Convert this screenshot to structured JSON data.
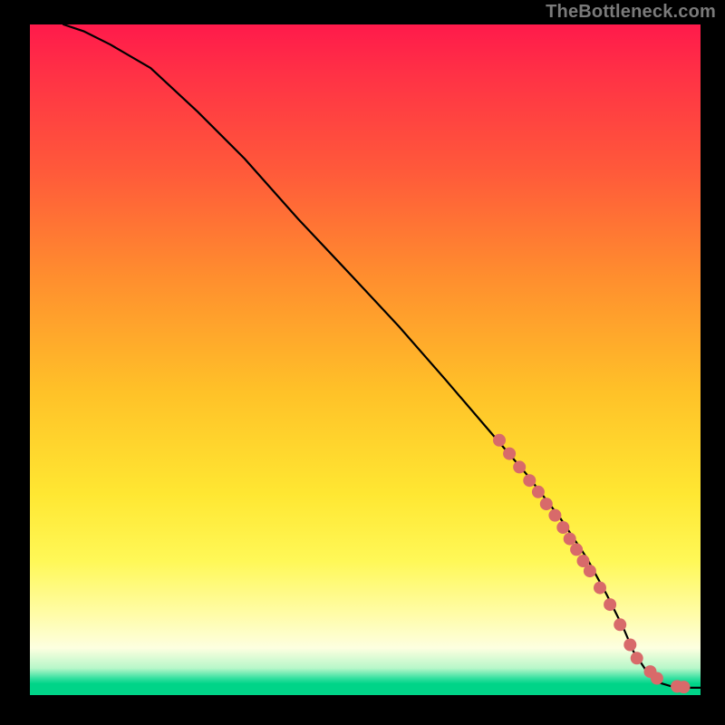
{
  "watermark": "TheBottleneck.com",
  "chart_data": {
    "type": "line",
    "title": "",
    "xlabel": "",
    "ylabel": "",
    "xlim": [
      0,
      100
    ],
    "ylim": [
      0,
      100
    ],
    "curve": {
      "name": "bottleneck-curve",
      "x": [
        5,
        8,
        12,
        18,
        25,
        32,
        40,
        48,
        55,
        62,
        68,
        74,
        79,
        83,
        86,
        88.5,
        90,
        92,
        94,
        96,
        98,
        100
      ],
      "y": [
        100,
        99,
        97,
        93.5,
        87,
        80,
        71,
        62.5,
        55,
        47,
        40,
        33,
        26.5,
        20.5,
        15,
        10,
        6.5,
        3.5,
        1.8,
        1.2,
        1.1,
        1.1
      ]
    },
    "markers": {
      "name": "highlighted-points",
      "color": "#d86a6a",
      "radius": 7,
      "x": [
        70,
        71.5,
        73,
        74.5,
        75.8,
        77,
        78.3,
        79.5,
        80.5,
        81.5,
        82.5,
        83.5,
        85,
        86.5,
        88,
        89.5,
        90.5,
        92.5,
        93.5,
        96.5,
        97.5
      ],
      "y": [
        38,
        36,
        34,
        32,
        30.3,
        28.5,
        26.8,
        25,
        23.3,
        21.7,
        20,
        18.5,
        16,
        13.5,
        10.5,
        7.5,
        5.5,
        3.5,
        2.5,
        1.3,
        1.2
      ]
    },
    "gradient_stops": [
      {
        "pos": 0.0,
        "color": "#ff1a4b"
      },
      {
        "pos": 0.22,
        "color": "#ff5a3a"
      },
      {
        "pos": 0.55,
        "color": "#ffc228"
      },
      {
        "pos": 0.8,
        "color": "#fff857"
      },
      {
        "pos": 0.93,
        "color": "#fdffe0"
      },
      {
        "pos": 0.975,
        "color": "#34e0a0"
      },
      {
        "pos": 1.0,
        "color": "#00d488"
      }
    ]
  }
}
